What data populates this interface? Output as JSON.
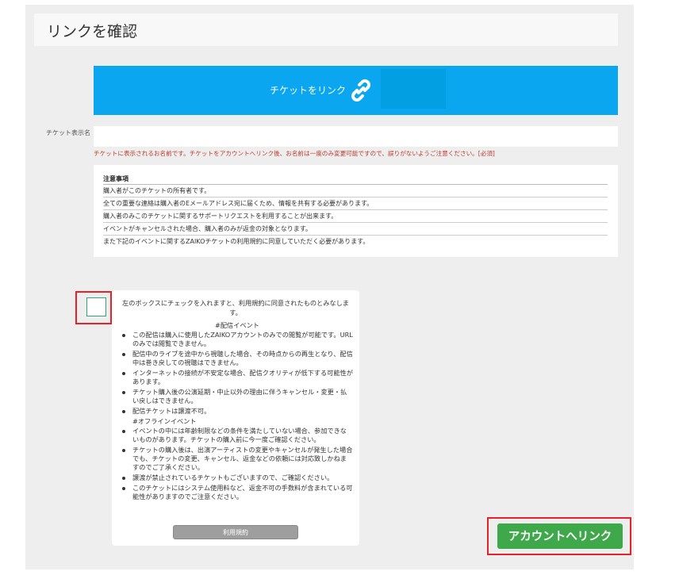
{
  "page": {
    "title": "リンクを確認"
  },
  "link_banner": {
    "label": "チケットをリンク",
    "icon": "link-icon"
  },
  "ticket_name": {
    "label": "チケット表示名",
    "value": "",
    "hint": "チケットに表示されるお名前です。チケットをアカウントへリンク後、お名前は一度のみ変更可能ですので、誤りがないようご注意ください。[必須]"
  },
  "notes": {
    "heading": "注意事項",
    "items": [
      "購入者がこのチケットの所有者です。",
      "全ての重要な連絡は購入者のEメールアドレス宛に届くため、情報を共有する必要があります。",
      "購入者のみこのチケットに関するサポートリクエストを利用することが出来ます。",
      "イベントがキャンセルされた場合、購入者のみが返金の対象となります。",
      "また下記のイベントに関するZAIKOチケットの利用規約に同意していただく必要があります。"
    ]
  },
  "terms": {
    "checked": false,
    "intro": "左のボックスにチェックを入れますと、利用規約に同意されたものとみなします。",
    "section_streaming": "#配信イベント",
    "streaming_items": [
      "この配信は購入に使用したZAIKOアカウントのみでの閲覧が可能です。URLのみでは閲覧できません。",
      "配信中のライブを途中から視聴した場合、その時点からの再生となり、配信中は巻き戻しての視聴はできません。",
      "インターネットの接続が不安定な場合、配信クオリティが低下する可能性があります。",
      "チケット購入後の公演延期・中止以外の理由に伴うキャンセル・変更・払い戻しはできません。",
      "配信チケットは譲渡不可。"
    ],
    "section_offline": "#オフラインイベント",
    "offline_items": [
      "イベントの中には年齢制限などの条件を満たしていない場合、参加できないものがあります。チケットの購入前に今一度ご確認ください。",
      "チケットの購入後は、出演アーティストの変更やキャンセルが発生した場合でも、チケットの変更、キャンセル、返金などの依頼には対応致しかねますのでご了承ください。",
      "譲渡が禁止されているチケットもございますので、ご確認ください。",
      "このチケットにはシステム使用料など、返金不可の手数料が含まれている可能性がありますのでご注意ください。"
    ],
    "rules_button": "利用規約"
  },
  "actions": {
    "link_account": "アカウントへリンク"
  },
  "colors": {
    "banner": "#0aa7f0",
    "primary_button": "#3ea84a",
    "highlight": "#e8202a",
    "hint_text": "#c0392b"
  }
}
